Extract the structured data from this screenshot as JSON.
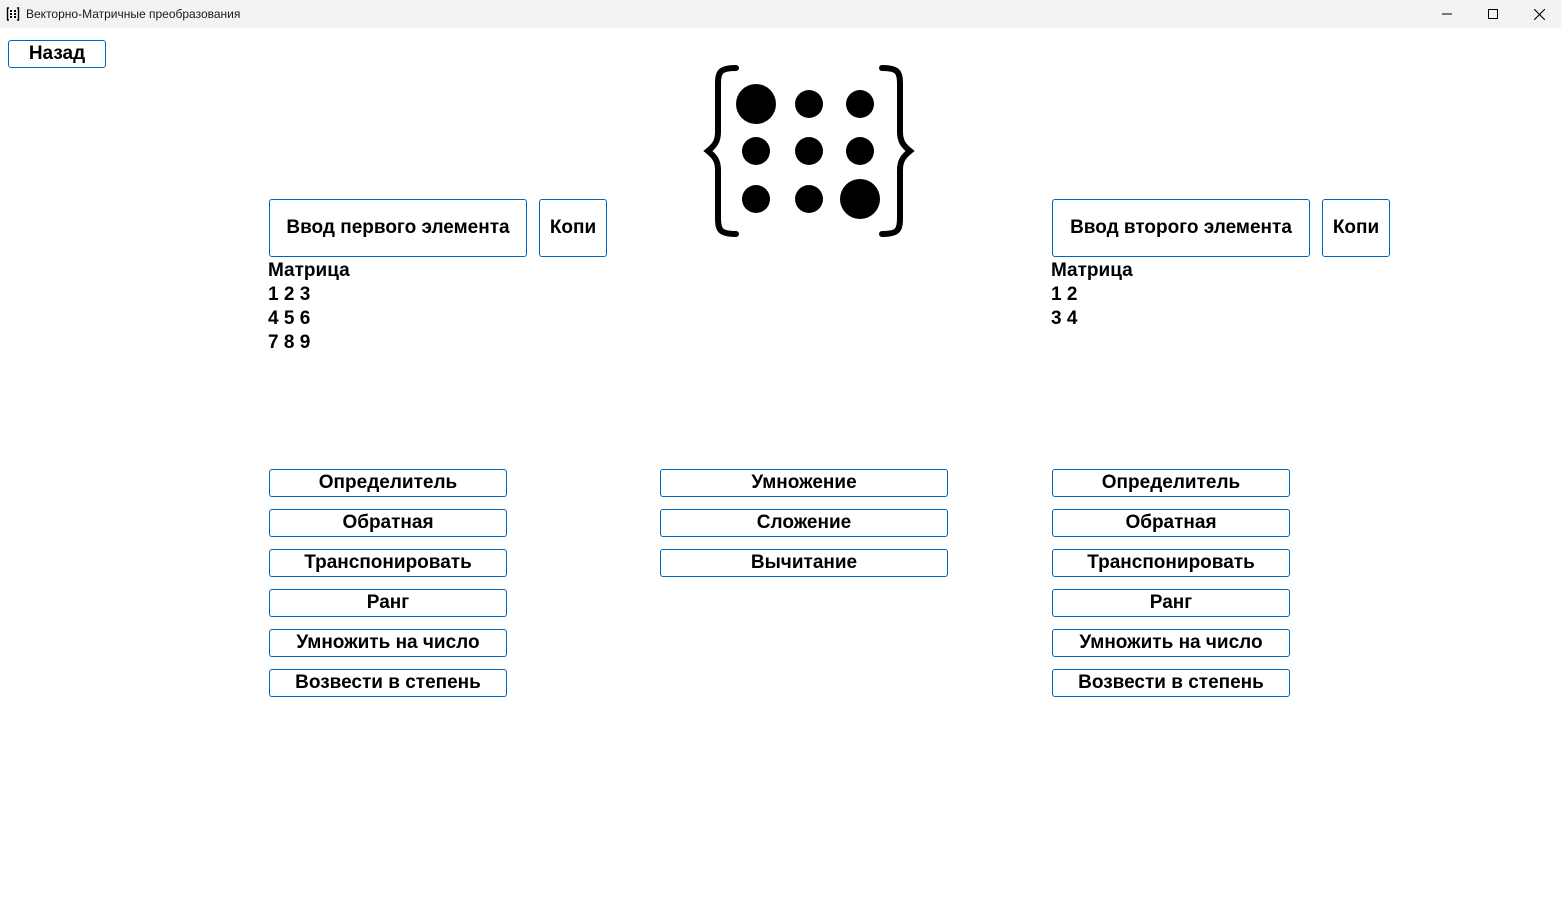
{
  "window": {
    "title": "Векторно-Матричные преобразования",
    "controls": [
      "minimize",
      "maximize",
      "close"
    ]
  },
  "nav": {
    "back_label": "Назад"
  },
  "left": {
    "input_label": "Ввод первого элемента",
    "copy_label": "Копи",
    "matrix_title": "Матрица",
    "matrix_rows": [
      "1 2 3",
      "4 5 6",
      "7 8 9"
    ],
    "ops": [
      "Определитель",
      "Обратная",
      "Транспонировать",
      "Ранг",
      "Умножить на число",
      "Возвести в степень"
    ]
  },
  "right": {
    "input_label": "Ввод второго элемента",
    "copy_label": "Копи",
    "matrix_title": "Матрица",
    "matrix_rows": [
      "1 2",
      "3 4"
    ],
    "ops": [
      "Определитель",
      "Обратная",
      "Транспонировать",
      "Ранг",
      "Умножить на число",
      "Возвести в степень"
    ]
  },
  "middle": {
    "ops": [
      "Умножение",
      "Сложение",
      "Вычитание"
    ]
  },
  "icons": {
    "app": "matrix-braces-icon",
    "logo": "matrix-dots-logo"
  },
  "colors": {
    "button_border": "#0067c0",
    "titlebar_bg": "#f3f3f3"
  }
}
